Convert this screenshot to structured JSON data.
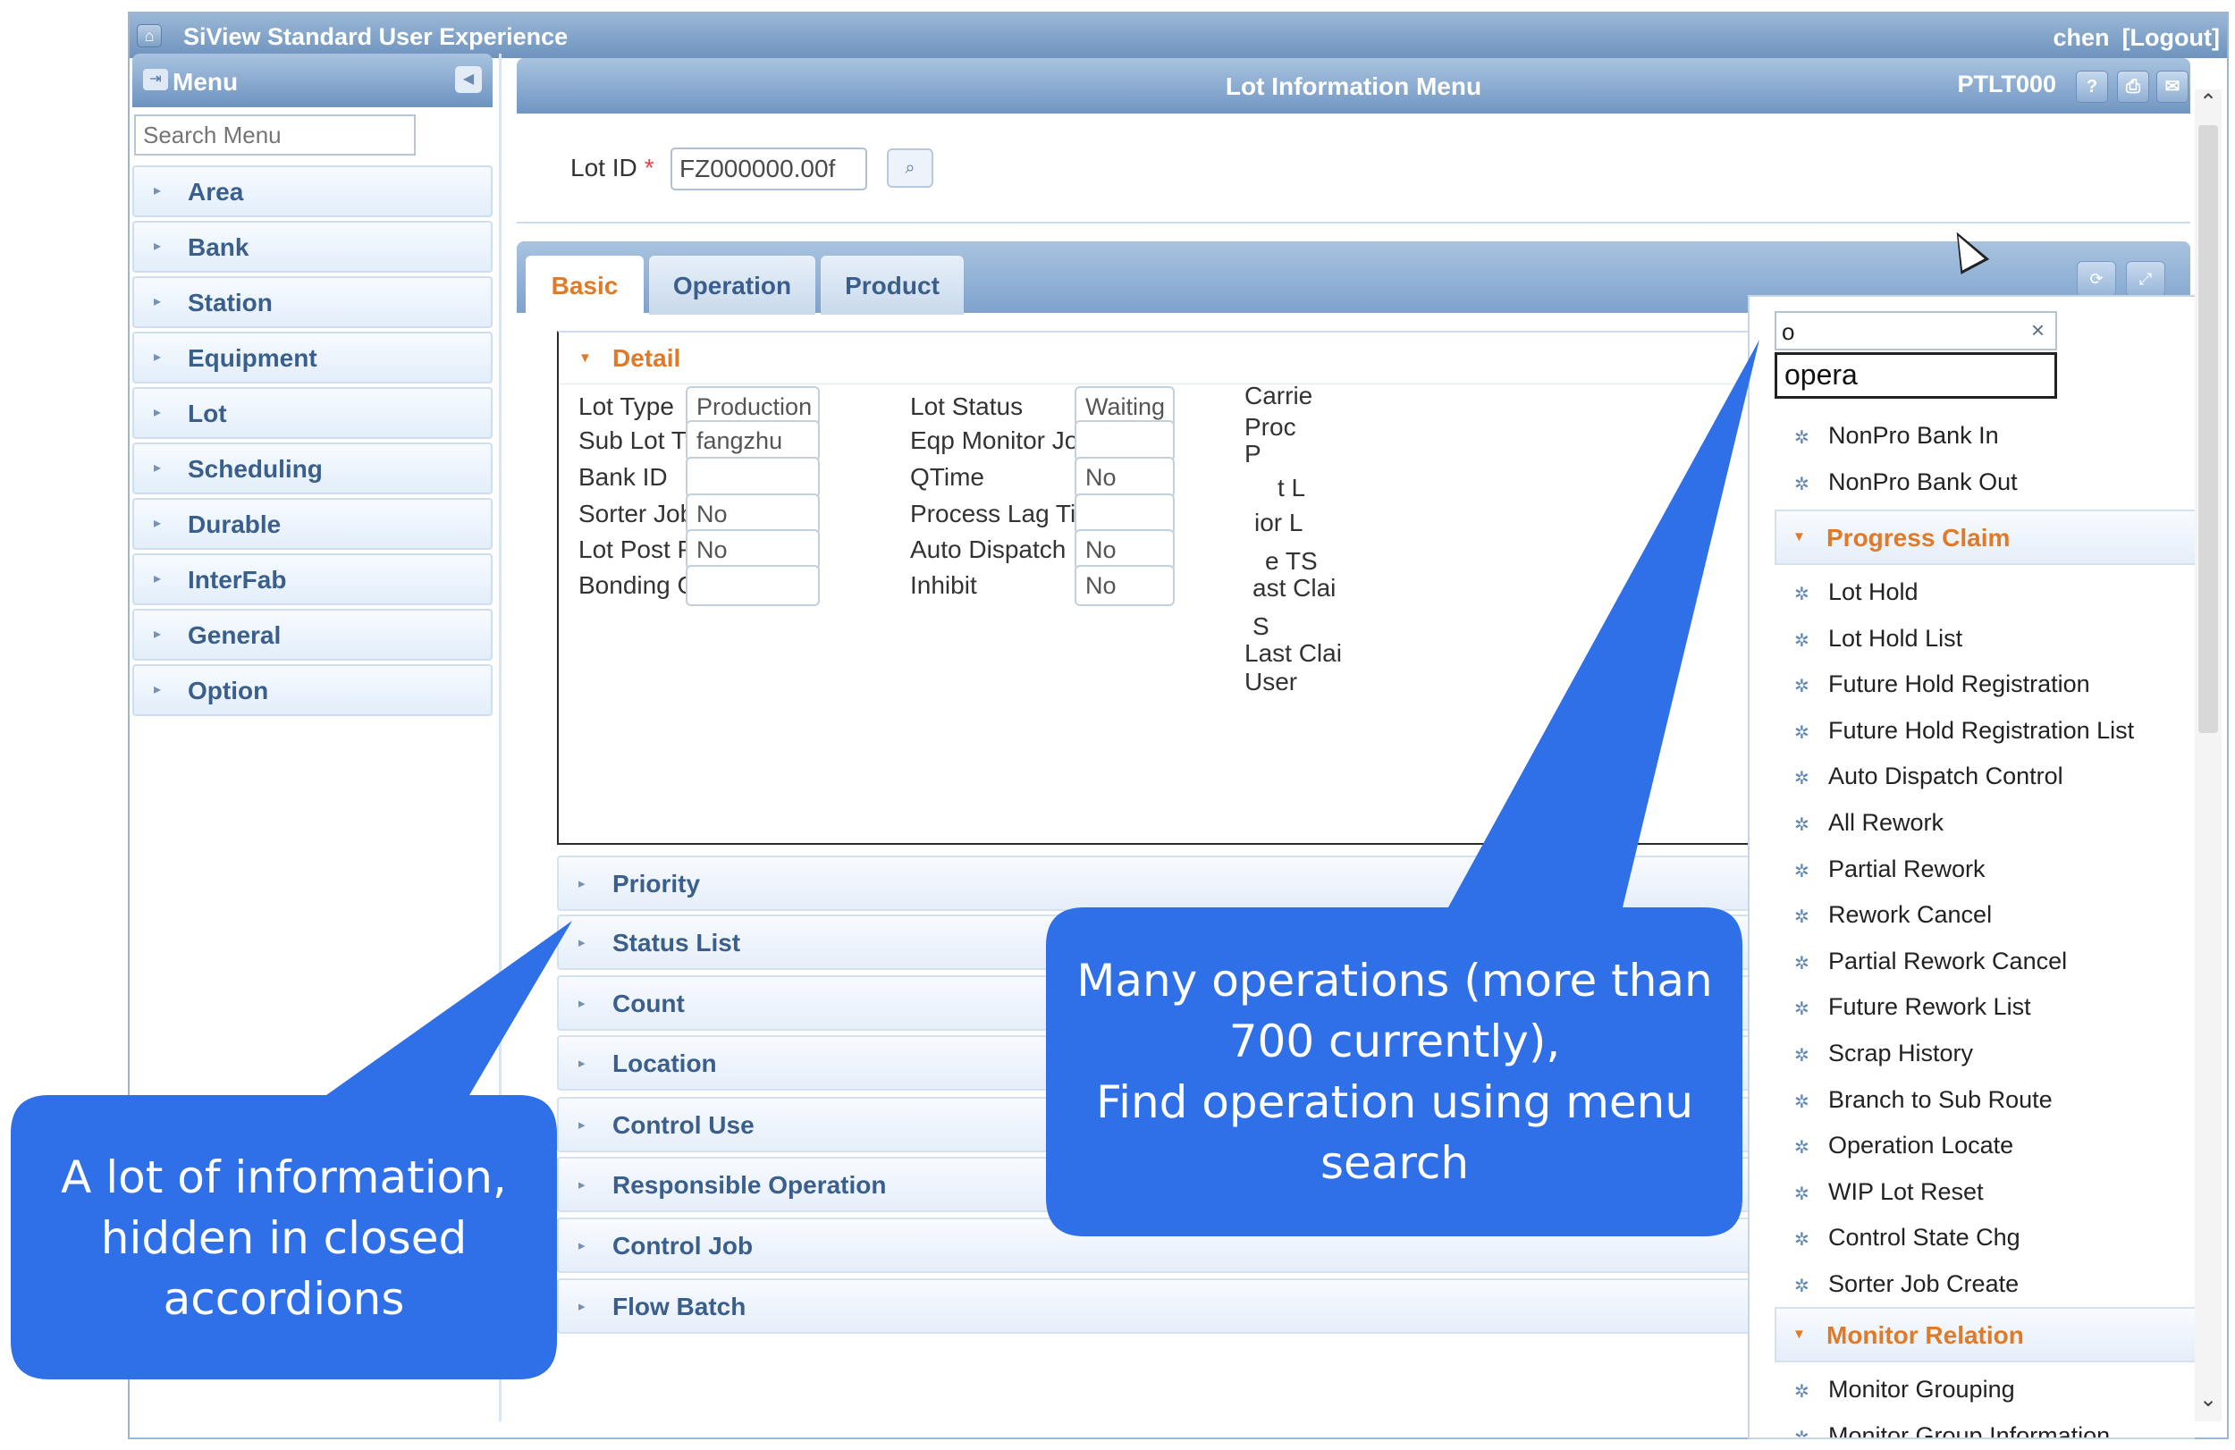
{
  "topbar": {
    "title": "SiView Standard User Experience",
    "user": "chen",
    "logout": "[Logout]"
  },
  "menu": {
    "title": "Menu",
    "search_placeholder": "Search Menu",
    "items": [
      {
        "label": "Area"
      },
      {
        "label": "Bank"
      },
      {
        "label": "Station"
      },
      {
        "label": "Equipment"
      },
      {
        "label": "Lot"
      },
      {
        "label": "Scheduling"
      },
      {
        "label": "Durable"
      },
      {
        "label": "InterFab"
      },
      {
        "label": "General"
      },
      {
        "label": "Option"
      }
    ]
  },
  "panel": {
    "title": "Lot Information Menu",
    "code": "PTLT000",
    "lot_id_label": "Lot ID",
    "lot_id_required": "*",
    "lot_id_value": "FZ000000.00f"
  },
  "tabs": [
    {
      "label": "Basic"
    },
    {
      "label": "Operation"
    },
    {
      "label": "Product"
    }
  ],
  "detail": {
    "title": "Detail",
    "left_fields": [
      {
        "label": "Lot Type",
        "value": "Production"
      },
      {
        "label": "Sub Lot Type",
        "value": "fangzhu"
      },
      {
        "label": "Bank ID",
        "value": ""
      },
      {
        "label": "Sorter Job",
        "value": "No"
      },
      {
        "label": "Lot Post Proc",
        "value": "No"
      },
      {
        "label": "Bonding Group",
        "value": ""
      }
    ],
    "mid_fields": [
      {
        "label": "Lot Status",
        "value": "Waiting"
      },
      {
        "label": "Eqp Monitor Job",
        "value": ""
      },
      {
        "label": "QTime",
        "value": "No"
      },
      {
        "label": "Process Lag Time",
        "value": ""
      },
      {
        "label": "Auto Dispatch Disabled",
        "value": "No"
      },
      {
        "label": "Inhibit",
        "value": "No"
      }
    ],
    "right_partial": [
      "Carrie",
      "Proc",
      "P",
      "t L",
      "ior L",
      "e TS",
      "ast Clai",
      "S",
      "Last Clai",
      "User"
    ]
  },
  "accordions": [
    {
      "label": "Priority"
    },
    {
      "label": "Status List"
    },
    {
      "label": "Count"
    },
    {
      "label": "Location"
    },
    {
      "label": "Control Use"
    },
    {
      "label": "Responsible Operation"
    },
    {
      "label": "Control Job"
    },
    {
      "label": "Flow Batch"
    }
  ],
  "dropdown": {
    "search_value": "o",
    "clear": "×",
    "suggestion": "opera",
    "top_items": [
      {
        "label": "NonPro Bank In"
      },
      {
        "label": "NonPro Bank Out"
      }
    ],
    "group1": {
      "title": "Progress Claim",
      "items": [
        {
          "label": "Lot Hold"
        },
        {
          "label": "Lot Hold List"
        },
        {
          "label": "Future Hold Registration"
        },
        {
          "label": "Future Hold Registration List"
        },
        {
          "label": "Auto Dispatch Control"
        },
        {
          "label": "All Rework"
        },
        {
          "label": "Partial Rework"
        },
        {
          "label": "Rework Cancel"
        },
        {
          "label": "Partial Rework Cancel"
        },
        {
          "label": "Future Rework List"
        },
        {
          "label": "Scrap History"
        },
        {
          "label": "Branch to Sub Route"
        },
        {
          "label": "Operation Locate"
        },
        {
          "label": "WIP Lot Reset"
        },
        {
          "label": "Control State Chg"
        },
        {
          "label": "Sorter Job Create"
        }
      ]
    },
    "group2": {
      "title": "Monitor Relation",
      "items": [
        {
          "label": "Monitor Grouping"
        },
        {
          "label": "Monitor Group Information"
        }
      ]
    }
  },
  "callouts": {
    "left": [
      "A lot of information,",
      "hidden in closed",
      "accordions"
    ],
    "right": [
      "Many operations (more than",
      "700 currently),",
      "Find operation using menu",
      "search"
    ],
    "color": "#2f6fe8"
  }
}
